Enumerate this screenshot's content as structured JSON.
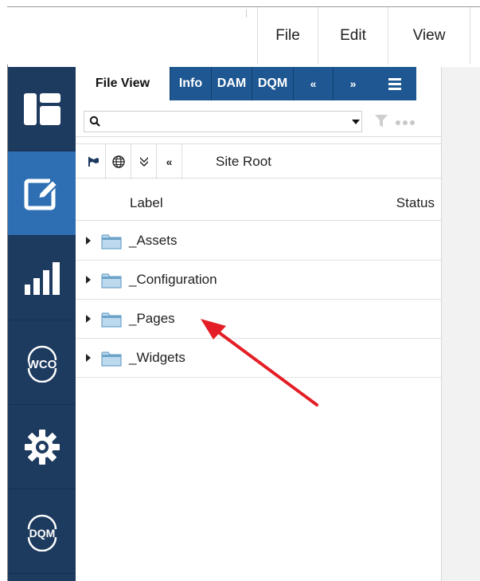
{
  "menu": {
    "file": "File",
    "edit": "Edit",
    "view": "View"
  },
  "sidebar": {
    "items": [
      {
        "icon": "dashboard-icon",
        "active": false
      },
      {
        "icon": "edit-icon",
        "active": true
      },
      {
        "icon": "bar-chart-icon",
        "active": false
      },
      {
        "icon": "wco-icon",
        "label": "WCO",
        "active": false
      },
      {
        "icon": "gear-icon",
        "active": false
      },
      {
        "icon": "dqm-icon",
        "label": "DQM",
        "active": false
      }
    ]
  },
  "tabs": {
    "file_view": "File View",
    "info": "Info",
    "dam": "DAM",
    "dqm": "DQM",
    "prev": "«",
    "next": "»"
  },
  "search": {
    "value": "",
    "placeholder": ""
  },
  "toolbar": {
    "back": "«",
    "site_root": "Site Root"
  },
  "columns": {
    "label": "Label",
    "status": "Status"
  },
  "tree": {
    "items": [
      {
        "name": "_Assets"
      },
      {
        "name": "_Configuration"
      },
      {
        "name": "_Pages"
      },
      {
        "name": "_Widgets"
      }
    ]
  },
  "colors": {
    "sidebar": "#1d3a5f",
    "sidebar_active": "#2e6fb3",
    "tab_blue": "#1e5792",
    "annotation_arrow": "#e41e26"
  }
}
